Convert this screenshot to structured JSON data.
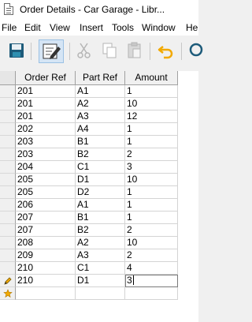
{
  "window": {
    "title": "Order Details - Car Garage - Libr..."
  },
  "menu": [
    "File",
    "Edit",
    "View",
    "Insert",
    "Tools",
    "Window",
    "He"
  ],
  "toolbar": {
    "icons": [
      "save-icon",
      "edit-mode-icon",
      "cut-icon",
      "copy-icon",
      "paste-icon",
      "undo-icon",
      "search-icon"
    ],
    "active": "edit-mode-icon"
  },
  "grid": {
    "columns": [
      "Order Ref",
      "Part Ref",
      "Amount"
    ],
    "rows": [
      [
        "201",
        "A1",
        "1"
      ],
      [
        "201",
        "A2",
        "10"
      ],
      [
        "201",
        "A3",
        "12"
      ],
      [
        "202",
        "A4",
        "1"
      ],
      [
        "203",
        "B1",
        "1"
      ],
      [
        "203",
        "B2",
        "2"
      ],
      [
        "204",
        "C1",
        "3"
      ],
      [
        "205",
        "D1",
        "10"
      ],
      [
        "205",
        "D2",
        "1"
      ],
      [
        "206",
        "A1",
        "1"
      ],
      [
        "207",
        "B1",
        "1"
      ],
      [
        "207",
        "B2",
        "2"
      ],
      [
        "208",
        "A2",
        "10"
      ],
      [
        "209",
        "A3",
        "2"
      ],
      [
        "210",
        "C1",
        "4"
      ],
      [
        "210",
        "D1",
        "3"
      ]
    ],
    "editing_row_indicator": "pencil-icon",
    "new_row_indicator": "new-row-star-icon"
  },
  "colors": {
    "accent": "#f2a900",
    "header_bg": "#f0f0f0",
    "grid_line": "#d4d4d4"
  }
}
